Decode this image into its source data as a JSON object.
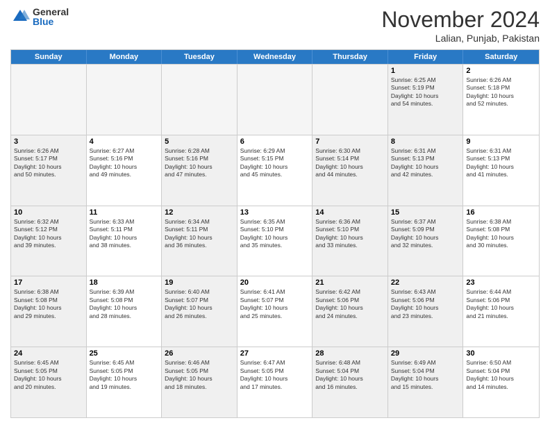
{
  "logo": {
    "general": "General",
    "blue": "Blue"
  },
  "title": "November 2024",
  "location": "Lalian, Punjab, Pakistan",
  "weekdays": [
    "Sunday",
    "Monday",
    "Tuesday",
    "Wednesday",
    "Thursday",
    "Friday",
    "Saturday"
  ],
  "rows": [
    [
      {
        "day": "",
        "empty": true
      },
      {
        "day": "",
        "empty": true
      },
      {
        "day": "",
        "empty": true
      },
      {
        "day": "",
        "empty": true
      },
      {
        "day": "",
        "empty": true
      },
      {
        "day": "1",
        "lines": [
          "Sunrise: 6:25 AM",
          "Sunset: 5:19 PM",
          "Daylight: 10 hours",
          "and 54 minutes."
        ],
        "shaded": true
      },
      {
        "day": "2",
        "lines": [
          "Sunrise: 6:26 AM",
          "Sunset: 5:18 PM",
          "Daylight: 10 hours",
          "and 52 minutes."
        ],
        "shaded": false
      }
    ],
    [
      {
        "day": "3",
        "lines": [
          "Sunrise: 6:26 AM",
          "Sunset: 5:17 PM",
          "Daylight: 10 hours",
          "and 50 minutes."
        ],
        "shaded": true
      },
      {
        "day": "4",
        "lines": [
          "Sunrise: 6:27 AM",
          "Sunset: 5:16 PM",
          "Daylight: 10 hours",
          "and 49 minutes."
        ]
      },
      {
        "day": "5",
        "lines": [
          "Sunrise: 6:28 AM",
          "Sunset: 5:16 PM",
          "Daylight: 10 hours",
          "and 47 minutes."
        ],
        "shaded": true
      },
      {
        "day": "6",
        "lines": [
          "Sunrise: 6:29 AM",
          "Sunset: 5:15 PM",
          "Daylight: 10 hours",
          "and 45 minutes."
        ]
      },
      {
        "day": "7",
        "lines": [
          "Sunrise: 6:30 AM",
          "Sunset: 5:14 PM",
          "Daylight: 10 hours",
          "and 44 minutes."
        ],
        "shaded": true
      },
      {
        "day": "8",
        "lines": [
          "Sunrise: 6:31 AM",
          "Sunset: 5:13 PM",
          "Daylight: 10 hours",
          "and 42 minutes."
        ],
        "shaded": true
      },
      {
        "day": "9",
        "lines": [
          "Sunrise: 6:31 AM",
          "Sunset: 5:13 PM",
          "Daylight: 10 hours",
          "and 41 minutes."
        ]
      }
    ],
    [
      {
        "day": "10",
        "lines": [
          "Sunrise: 6:32 AM",
          "Sunset: 5:12 PM",
          "Daylight: 10 hours",
          "and 39 minutes."
        ],
        "shaded": true
      },
      {
        "day": "11",
        "lines": [
          "Sunrise: 6:33 AM",
          "Sunset: 5:11 PM",
          "Daylight: 10 hours",
          "and 38 minutes."
        ]
      },
      {
        "day": "12",
        "lines": [
          "Sunrise: 6:34 AM",
          "Sunset: 5:11 PM",
          "Daylight: 10 hours",
          "and 36 minutes."
        ],
        "shaded": true
      },
      {
        "day": "13",
        "lines": [
          "Sunrise: 6:35 AM",
          "Sunset: 5:10 PM",
          "Daylight: 10 hours",
          "and 35 minutes."
        ]
      },
      {
        "day": "14",
        "lines": [
          "Sunrise: 6:36 AM",
          "Sunset: 5:10 PM",
          "Daylight: 10 hours",
          "and 33 minutes."
        ],
        "shaded": true
      },
      {
        "day": "15",
        "lines": [
          "Sunrise: 6:37 AM",
          "Sunset: 5:09 PM",
          "Daylight: 10 hours",
          "and 32 minutes."
        ],
        "shaded": true
      },
      {
        "day": "16",
        "lines": [
          "Sunrise: 6:38 AM",
          "Sunset: 5:08 PM",
          "Daylight: 10 hours",
          "and 30 minutes."
        ]
      }
    ],
    [
      {
        "day": "17",
        "lines": [
          "Sunrise: 6:38 AM",
          "Sunset: 5:08 PM",
          "Daylight: 10 hours",
          "and 29 minutes."
        ],
        "shaded": true
      },
      {
        "day": "18",
        "lines": [
          "Sunrise: 6:39 AM",
          "Sunset: 5:08 PM",
          "Daylight: 10 hours",
          "and 28 minutes."
        ]
      },
      {
        "day": "19",
        "lines": [
          "Sunrise: 6:40 AM",
          "Sunset: 5:07 PM",
          "Daylight: 10 hours",
          "and 26 minutes."
        ],
        "shaded": true
      },
      {
        "day": "20",
        "lines": [
          "Sunrise: 6:41 AM",
          "Sunset: 5:07 PM",
          "Daylight: 10 hours",
          "and 25 minutes."
        ]
      },
      {
        "day": "21",
        "lines": [
          "Sunrise: 6:42 AM",
          "Sunset: 5:06 PM",
          "Daylight: 10 hours",
          "and 24 minutes."
        ],
        "shaded": true
      },
      {
        "day": "22",
        "lines": [
          "Sunrise: 6:43 AM",
          "Sunset: 5:06 PM",
          "Daylight: 10 hours",
          "and 23 minutes."
        ],
        "shaded": true
      },
      {
        "day": "23",
        "lines": [
          "Sunrise: 6:44 AM",
          "Sunset: 5:06 PM",
          "Daylight: 10 hours",
          "and 21 minutes."
        ]
      }
    ],
    [
      {
        "day": "24",
        "lines": [
          "Sunrise: 6:45 AM",
          "Sunset: 5:05 PM",
          "Daylight: 10 hours",
          "and 20 minutes."
        ],
        "shaded": true
      },
      {
        "day": "25",
        "lines": [
          "Sunrise: 6:45 AM",
          "Sunset: 5:05 PM",
          "Daylight: 10 hours",
          "and 19 minutes."
        ]
      },
      {
        "day": "26",
        "lines": [
          "Sunrise: 6:46 AM",
          "Sunset: 5:05 PM",
          "Daylight: 10 hours",
          "and 18 minutes."
        ],
        "shaded": true
      },
      {
        "day": "27",
        "lines": [
          "Sunrise: 6:47 AM",
          "Sunset: 5:05 PM",
          "Daylight: 10 hours",
          "and 17 minutes."
        ]
      },
      {
        "day": "28",
        "lines": [
          "Sunrise: 6:48 AM",
          "Sunset: 5:04 PM",
          "Daylight: 10 hours",
          "and 16 minutes."
        ],
        "shaded": true
      },
      {
        "day": "29",
        "lines": [
          "Sunrise: 6:49 AM",
          "Sunset: 5:04 PM",
          "Daylight: 10 hours",
          "and 15 minutes."
        ],
        "shaded": true
      },
      {
        "day": "30",
        "lines": [
          "Sunrise: 6:50 AM",
          "Sunset: 5:04 PM",
          "Daylight: 10 hours",
          "and 14 minutes."
        ]
      }
    ]
  ]
}
